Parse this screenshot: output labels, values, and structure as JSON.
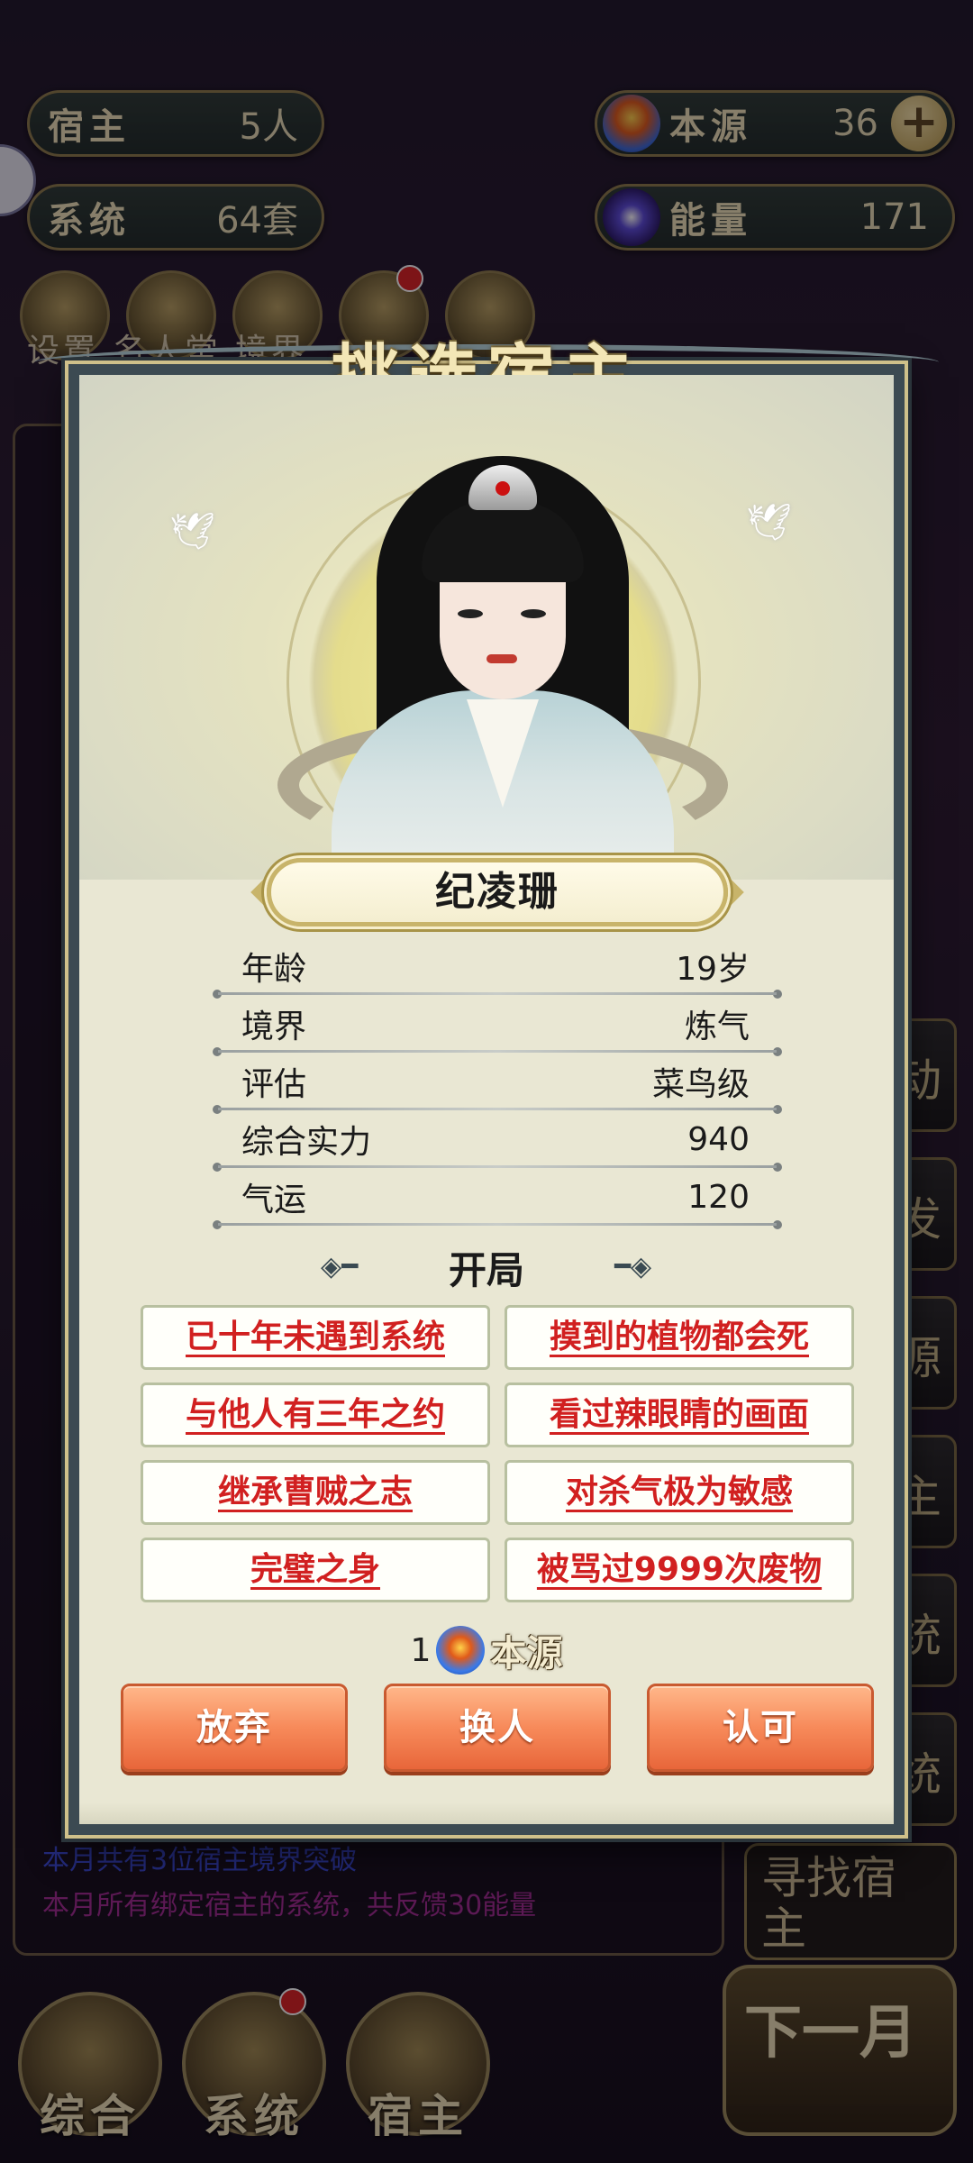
{
  "hud": {
    "host": {
      "label": "宿主",
      "value": "5人"
    },
    "system": {
      "label": "系统",
      "value": "64套"
    },
    "source": {
      "label": "本源",
      "value": "36",
      "icon": "source-orb-icon"
    },
    "energy": {
      "label": "能量",
      "value": "171",
      "icon": "energy-swirl-icon"
    }
  },
  "top_menu_labels": "设置 名人堂 境界",
  "log_lines": [
    {
      "text": "本月共有3位宿主境界突破",
      "color": "#3a4ad8"
    },
    {
      "text": "本月所有绑定宿主的系统，共反馈30能量",
      "color": "#a02a90"
    }
  ],
  "right_tabs": [
    "动",
    "发",
    "源",
    "主",
    "统",
    "统"
  ],
  "find_host_label": "寻找宿主",
  "bottom_nav": {
    "overview": "综合",
    "system": "系统",
    "host": "宿主",
    "next_month": "下一月"
  },
  "modal": {
    "title": "挑选宿主",
    "character_name": "纪凌珊",
    "stats": [
      {
        "label": "年龄",
        "value": "19岁"
      },
      {
        "label": "境界",
        "value": "炼气"
      },
      {
        "label": "评估",
        "value": "菜鸟级"
      },
      {
        "label": "综合实力",
        "value": "940"
      },
      {
        "label": "气运",
        "value": "120"
      }
    ],
    "opening_title": "开局",
    "traits": [
      "已十年未遇到系统",
      "摸到的植物都会死",
      "与他人有三年之约",
      "看过辣眼睛的画面",
      "继承曹贼之志",
      "对杀气极为敏感",
      "完璧之身",
      "被骂过9999次废物"
    ],
    "cost": {
      "amount": "1",
      "currency": "本源"
    },
    "actions": {
      "abandon": "放弃",
      "swap": "换人",
      "approve": "认可"
    }
  },
  "colors": {
    "trait_text": "#d12020",
    "button_orange": "#f78a5a",
    "frame": "#3c4a52",
    "panel": "#e9e7d3"
  }
}
